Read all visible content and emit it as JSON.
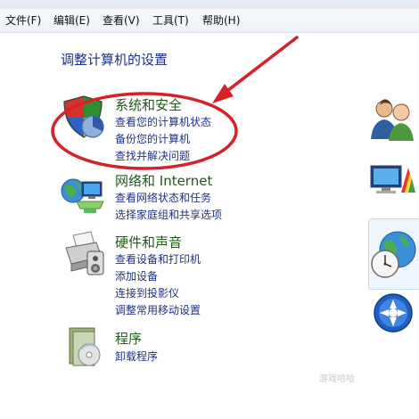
{
  "menu": {
    "items": [
      {
        "label": "文件(F)"
      },
      {
        "label": "编辑(E)"
      },
      {
        "label": "查看(V)"
      },
      {
        "label": "工具(T)"
      },
      {
        "label": "帮助(H)"
      }
    ]
  },
  "main": {
    "title": "调整计算机的设置",
    "categories": [
      {
        "title": "系统和安全",
        "icon": "shield-icon",
        "links": [
          "查看您的计算机状态",
          "备份您的计算机",
          "查找并解决问题"
        ]
      },
      {
        "title": "网络和 Internet",
        "icon": "network-icon",
        "links": [
          "查看网络状态和任务",
          "选择家庭组和共享选项"
        ]
      },
      {
        "title": "硬件和声音",
        "icon": "printer-icon",
        "links": [
          "查看设备和打印机",
          "添加设备",
          "连接到投影仪",
          "调整常用移动设置"
        ]
      },
      {
        "title": "程序",
        "icon": "programs-icon",
        "links": [
          "卸载程序"
        ]
      }
    ]
  },
  "right_icons": [
    "user-accounts-icon",
    "appearance-icon",
    "clock-region-icon",
    "ease-of-access-icon"
  ],
  "colors": {
    "link": "#1e3287",
    "category_title": "#1e5a1a",
    "annotation": "#d6202a"
  },
  "watermark": "游戏哈哈"
}
